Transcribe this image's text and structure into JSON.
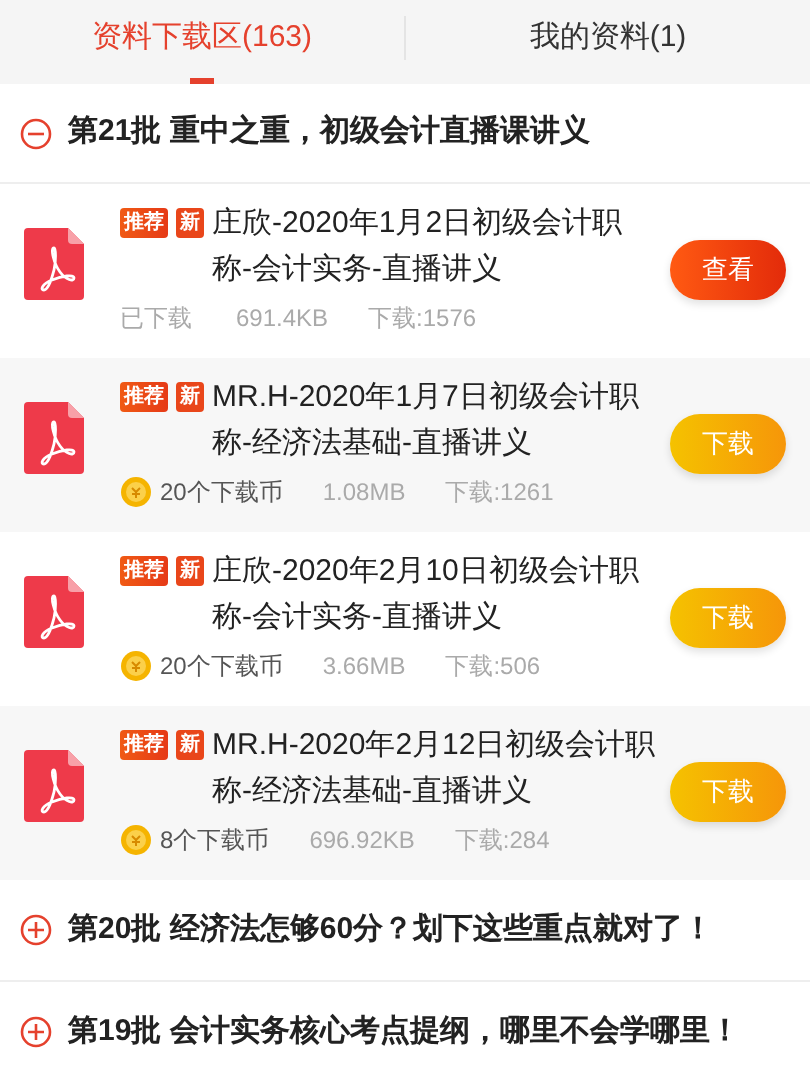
{
  "tabs": [
    {
      "label": "资料下载区(163)",
      "selected": true
    },
    {
      "label": "我的资料(1)",
      "selected": false
    }
  ],
  "sections": [
    {
      "title": "第21批 重中之重，初级会计直播课讲义",
      "expanded": true,
      "files": [
        {
          "title": "庄欣-2020年1月2日初级会计职称-会计实务-直播讲义",
          "tags": [
            {
              "label": "推荐",
              "kind": "recommend"
            },
            {
              "label": "新",
              "kind": "new"
            }
          ],
          "kind": "downloaded",
          "cost": "已下载",
          "size": "691.4KB",
          "downloads": "下载:1576",
          "button": {
            "label": "查看",
            "kind": "view"
          }
        },
        {
          "title": "MR.H-2020年1月7日初级会计职称-经济法基础-直播讲义",
          "tags": [
            {
              "label": "推荐",
              "kind": "recommend"
            },
            {
              "label": "新",
              "kind": "new"
            }
          ],
          "kind": "coins",
          "cost": "20个下载币",
          "size": "1.08MB",
          "downloads": "下载:1261",
          "button": {
            "label": "下载",
            "kind": "download"
          }
        },
        {
          "title": "庄欣-2020年2月10日初级会计职称-会计实务-直播讲义",
          "tags": [
            {
              "label": "推荐",
              "kind": "recommend"
            },
            {
              "label": "新",
              "kind": "new"
            }
          ],
          "kind": "coins",
          "cost": "20个下载币",
          "size": "3.66MB",
          "downloads": "下载:506",
          "button": {
            "label": "下载",
            "kind": "download"
          }
        },
        {
          "title": "MR.H-2020年2月12日初级会计职称-经济法基础-直播讲义",
          "tags": [
            {
              "label": "推荐",
              "kind": "recommend"
            },
            {
              "label": "新",
              "kind": "new"
            }
          ],
          "kind": "coins",
          "cost": "8个下载币",
          "size": "696.92KB",
          "downloads": "下载:284",
          "button": {
            "label": "下载",
            "kind": "download"
          }
        }
      ]
    },
    {
      "title": "第20批 经济法怎够60分？划下这些重点就对了！",
      "expanded": false
    },
    {
      "title": "第19批 会计实务核心考点提纲，哪里不会学哪里！",
      "expanded": false
    }
  ]
}
